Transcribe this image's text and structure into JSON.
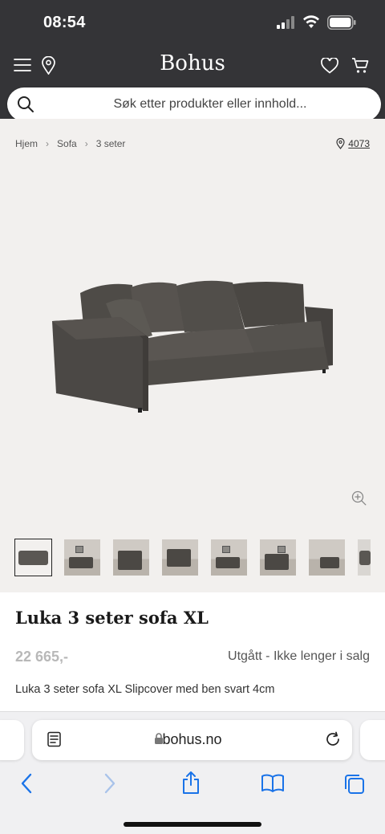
{
  "status_bar": {
    "time": "08:54"
  },
  "header": {
    "brand": "Bohus"
  },
  "search": {
    "placeholder": "Søk etter produkter eller innhold..."
  },
  "breadcrumb": {
    "items": [
      "Hjem",
      "Sofa",
      "3 seter"
    ],
    "store_number": "4073"
  },
  "product": {
    "title": "Luka 3 seter sofa XL",
    "price": "22 665,-",
    "availability": "Utgått - Ikke lenger i salg",
    "description": "Luka 3 seter sofa XL Slipcover med ben svart 4cm"
  },
  "browser": {
    "address": "bohus.no"
  },
  "colors": {
    "header_bg": "#343437",
    "image_bg": "#f2f0ee",
    "ios_blue": "#1a73e8"
  }
}
